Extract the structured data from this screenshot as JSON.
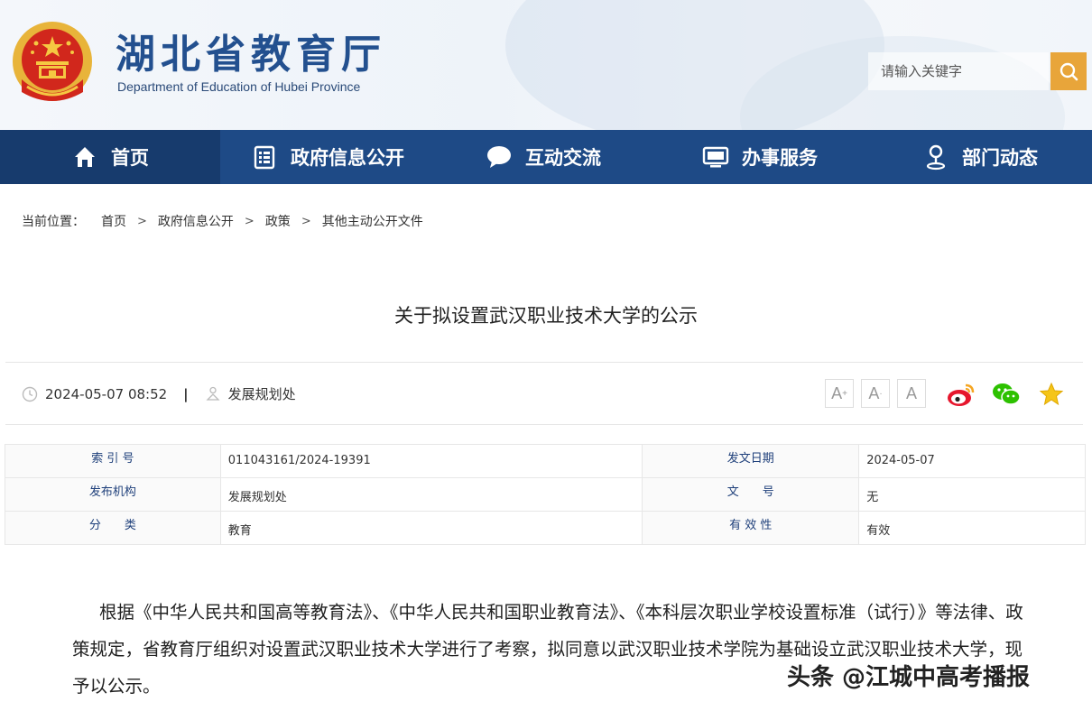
{
  "header": {
    "site_title": "湖北省教育厅",
    "site_subtitle": "Department of Education of Hubei Province",
    "search_placeholder": "请输入关键字"
  },
  "nav": {
    "items": [
      {
        "label": "首页",
        "icon": "home-icon"
      },
      {
        "label": "政府信息公开",
        "icon": "document-list-icon"
      },
      {
        "label": "互动交流",
        "icon": "chat-bubble-icon"
      },
      {
        "label": "办事服务",
        "icon": "monitor-icon"
      },
      {
        "label": "部门动态",
        "icon": "person-pin-icon"
      }
    ],
    "active_index": 0,
    "colors": {
      "bar": "#1e4a86",
      "active": "#173b6d"
    }
  },
  "breadcrumb": {
    "label": "当前位置：",
    "items": [
      "首页",
      "政府信息公开",
      "政策",
      "其他主动公开文件"
    ],
    "separator": ">"
  },
  "article": {
    "title": "关于拟设置武汉职业技术大学的公示",
    "datetime": "2024-05-07 08:52",
    "divider": "|",
    "source": "发展规划处",
    "font_buttons": [
      "A+",
      "A",
      "A-"
    ],
    "share_icons": [
      "weibo-icon",
      "wechat-icon",
      "favorite-star-icon"
    ]
  },
  "info_table": {
    "rows": [
      {
        "label1": "索 引 号",
        "value1": "011043161/2024-19391",
        "label2": "发文日期",
        "value2": "2024-05-07"
      },
      {
        "label1": "发布机构",
        "value1": "发展规划处",
        "label2": "文　　号",
        "value2": "无"
      },
      {
        "label1": "分　　类",
        "value1": "教育",
        "label2": "有 效 性",
        "value2": "有效"
      }
    ]
  },
  "body": {
    "paragraph": "根据《中华人民共和国高等教育法》、《中华人民共和国职业教育法》、《本科层次职业学校设置标准（试行）》等法律、政策规定，省教育厅组织对设置武汉职业技术大学进行了考察，拟同意以武汉职业技术学院为基础设立武汉职业技术大学，现予以公示。"
  },
  "watermark": "头条 @江城中高考播报",
  "colors": {
    "brand": "#23508f",
    "search_button": "#e8a53a"
  }
}
